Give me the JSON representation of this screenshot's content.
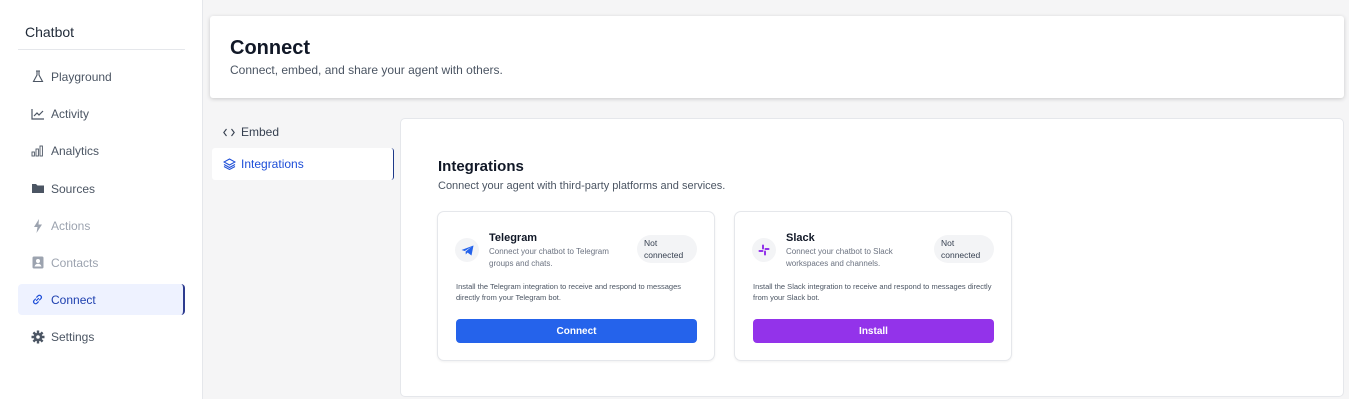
{
  "sidebar": {
    "title": "Chatbot",
    "items": [
      {
        "label": "Playground",
        "icon": "flask-icon"
      },
      {
        "label": "Activity",
        "icon": "activity-chart-icon"
      },
      {
        "label": "Analytics",
        "icon": "bar-chart-icon"
      },
      {
        "label": "Sources",
        "icon": "folder-icon"
      },
      {
        "label": "Actions",
        "icon": "lightning-icon",
        "disabled": true
      },
      {
        "label": "Contacts",
        "icon": "contact-card-icon",
        "disabled": true
      },
      {
        "label": "Connect",
        "icon": "link-icon",
        "active": true
      },
      {
        "label": "Settings",
        "icon": "gear-icon"
      }
    ]
  },
  "header": {
    "title": "Connect",
    "subtitle": "Connect, embed, and share your agent with others."
  },
  "subnav": {
    "items": [
      {
        "label": "Embed",
        "icon": "code-icon"
      },
      {
        "label": "Integrations",
        "icon": "layers-icon",
        "active": true
      }
    ]
  },
  "integrations": {
    "title": "Integrations",
    "subtitle": "Connect your agent with third-party platforms and services.",
    "cards": [
      {
        "name": "Telegram",
        "description": "Connect your chatbot to Telegram groups and chats.",
        "status": "Not connected",
        "body": "Install the Telegram integration to receive and respond to messages directly from your Telegram bot.",
        "button": "Connect",
        "button_color": "#2563eb",
        "icon": "telegram-icon"
      },
      {
        "name": "Slack",
        "description": "Connect your chatbot to Slack workspaces and channels.",
        "status": "Not connected",
        "body": "Install the Slack integration to receive and respond to messages directly from your Slack bot.",
        "button": "Install",
        "button_color": "#9333ea",
        "icon": "slack-icon"
      }
    ]
  },
  "colors": {
    "accent": "#1d4ed8",
    "active_bg": "#eef2ff"
  }
}
